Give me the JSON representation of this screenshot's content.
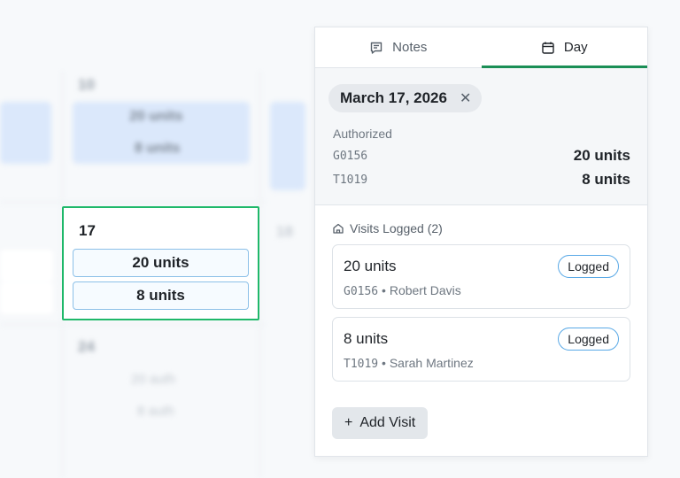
{
  "calendar": {
    "prev_row_day": "10",
    "prev_row_chips": [
      "20 units",
      "8 units"
    ],
    "next_day_faint": "18",
    "next_row_day": "24",
    "next_row_chips": [
      "20 auth",
      "8 auth"
    ],
    "selected_day": {
      "number": "17",
      "chips": [
        "20 units",
        "8 units"
      ]
    }
  },
  "panel": {
    "tabs": [
      {
        "label": "Notes",
        "icon": "notes-icon",
        "active": false
      },
      {
        "label": "Day",
        "icon": "calendar-icon",
        "active": true
      }
    ],
    "date_pill": "March 17, 2026",
    "authorized": {
      "label": "Authorized",
      "rows": [
        {
          "code": "G0156",
          "units": "20 units"
        },
        {
          "code": "T1019",
          "units": "8 units"
        }
      ]
    },
    "visits": {
      "header": "Visits Logged (2)",
      "items": [
        {
          "units": "20 units",
          "code": "G0156",
          "person": "Robert Davis",
          "status": "Logged"
        },
        {
          "units": "8 units",
          "code": "T1019",
          "person": "Sarah Martinez",
          "status": "Logged"
        }
      ]
    },
    "add_visit_label": "Add Visit"
  },
  "colors": {
    "accent": "#1b8f56",
    "selection_border": "#1fb86a",
    "chip_border": "#8cc0e8",
    "badge_border": "#5aa9e6"
  }
}
